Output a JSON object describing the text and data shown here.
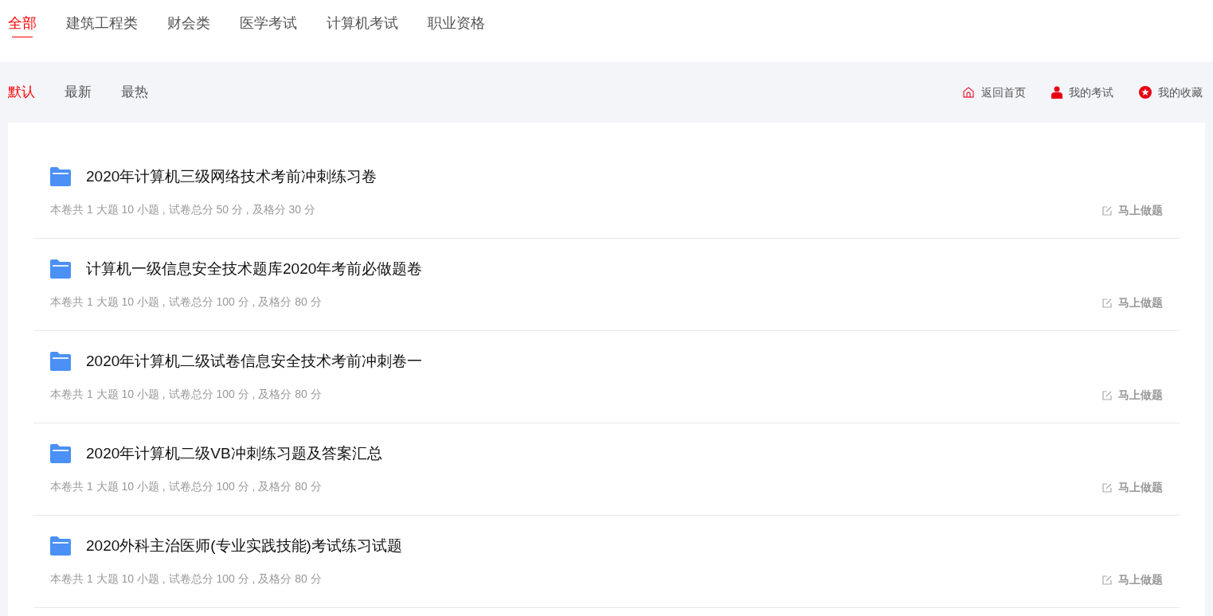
{
  "categories": [
    {
      "label": "全部",
      "selected": true
    },
    {
      "label": "建筑工程类",
      "selected": false
    },
    {
      "label": "财会类",
      "selected": false
    },
    {
      "label": "医学考试",
      "selected": false
    },
    {
      "label": "计算机考试",
      "selected": false
    },
    {
      "label": "职业资格",
      "selected": false
    }
  ],
  "sort_tabs": [
    {
      "label": "默认",
      "selected": true
    },
    {
      "label": "最新",
      "selected": false
    },
    {
      "label": "最热",
      "selected": false
    }
  ],
  "quick_links": [
    {
      "kind": "home",
      "label": "返回首页"
    },
    {
      "kind": "user",
      "label": "我的考试"
    },
    {
      "kind": "star",
      "label": "我的收藏"
    }
  ],
  "papers": [
    {
      "title": "2020年计算机三级网络技术考前冲刺练习卷",
      "info": "本卷共 1 大题 10 小题 , 试卷总分 50 分 , 及格分 30 分",
      "action": "马上做题"
    },
    {
      "title": "计算机一级信息安全技术题库2020年考前必做题卷",
      "info": "本卷共 1 大题 10 小题 , 试卷总分 100 分 , 及格分 80 分",
      "action": "马上做题"
    },
    {
      "title": "2020年计算机二级试卷信息安全技术考前冲刺卷一",
      "info": "本卷共 1 大题 10 小题 , 试卷总分 100 分 , 及格分 80 分",
      "action": "马上做题"
    },
    {
      "title": "2020年计算机二级VB冲刺练习题及答案汇总",
      "info": "本卷共 1 大题 10 小题 , 试卷总分 100 分 , 及格分 80 分",
      "action": "马上做题"
    },
    {
      "title": "2020外科主治医师(专业实践技能)考试练习试题",
      "info": "本卷共 1 大题 10 小题 , 试卷总分 100 分 , 及格分 80 分",
      "action": "马上做题"
    }
  ]
}
